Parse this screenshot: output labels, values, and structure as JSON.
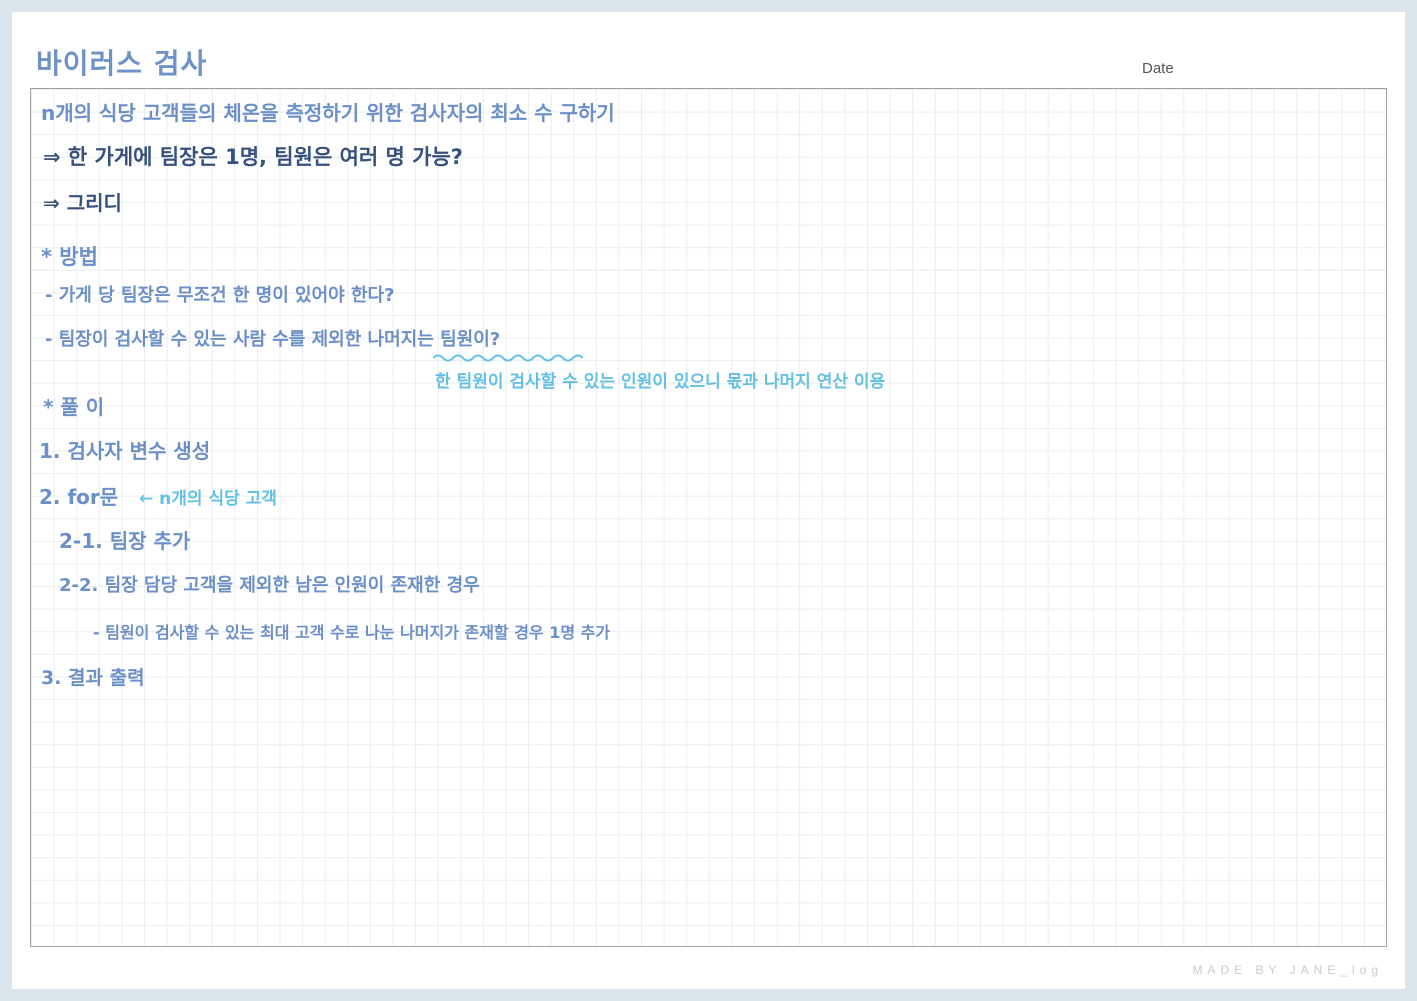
{
  "title": "바이러스 검사",
  "date_label": "Date",
  "lines": {
    "l1": "n개의 식당 고객들의 체온을 측정하기 위한 검사자의 최소 수 구하기",
    "l2": "⇒ 한 가게에 팀장은 1명, 팀원은 여러 명 가능?",
    "l3": "⇒ 그리디",
    "l4": "* 방법",
    "l5": "- 가게 당 팀장은 무조건 한 명이 있어야 한다?",
    "l6": "- 팀장이 검사할 수 있는 사람 수를 제외한 나머지는 팀원이?",
    "l7": "한 팀원이 검사할 수 있는 인원이 있으니 몫과 나머지 연산 이용",
    "l8": "* 풀 이",
    "l9": "1. 검사자 변수 생성",
    "l10_main": "2. for문",
    "l10_note": "← n개의 식당 고객",
    "l11": "2-1. 팀장 추가",
    "l12": "2-2. 팀장 담당 고객을 제외한 남은 인원이 존재한 경우",
    "l13": "- 팀원이 검사할 수 있는 최대 고객 수로 나눈 나머지가 존재할 경우 1명 추가",
    "l14": "3. 결과 출력"
  },
  "footer": "MADE BY JANE_log",
  "colors": {
    "handwriting_blue": "#6b8fc6",
    "handwriting_navy": "#37507c",
    "handwriting_cyan": "#63c0e4",
    "background": "#d9e5eb"
  }
}
